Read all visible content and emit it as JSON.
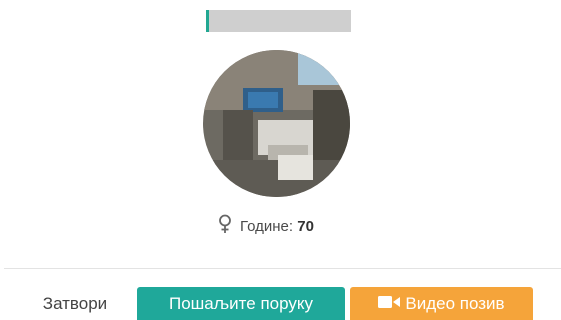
{
  "profile": {
    "age_label": "Године:",
    "age_value": "70",
    "gender_icon": "female-symbol-icon"
  },
  "actions": {
    "close_label": "Затвори",
    "message_label": "Пошаљите поруку",
    "video_label": "Видео позив",
    "video_icon": "video-camera-icon"
  },
  "colors": {
    "message_button": "#1fa89a",
    "video_button": "#f5a43a"
  }
}
